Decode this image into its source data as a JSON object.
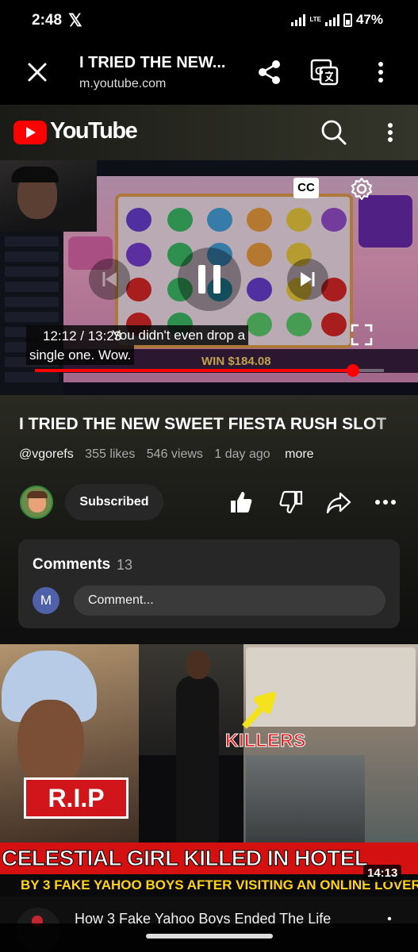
{
  "status_bar": {
    "time": "2:48",
    "notification_app": "𝕏",
    "network": "LTE",
    "battery": "47%"
  },
  "toolbar": {
    "title": "I TRIED THE NEW...",
    "url": "m.youtube.com",
    "close_icon": "close-icon",
    "share_icon": "share-icon",
    "translate_icon": "translate-icon",
    "menu_icon": "more-vert-icon"
  },
  "youtube_header": {
    "logo_text": "YouTube",
    "colors": {
      "brand": "#ff0000"
    }
  },
  "player": {
    "current_time": "12:12",
    "duration": "13:23",
    "time_display": "12:12 / 13:23",
    "progress_fraction": 0.9116,
    "caption_line1": "You didn't even drop a",
    "caption_line2": "single one. Wow.",
    "cc_label": "CC",
    "game_win_text": "WIN $184.08"
  },
  "video_info": {
    "title": "I TRIED THE NEW SWEET FIESTA RUSH SLOT",
    "channel": "@vgorefs",
    "likes": "355 likes",
    "views": "546 views",
    "age": "1 day ago",
    "more_label": "more",
    "subscribe_label": "Subscribed"
  },
  "comments": {
    "label": "Comments",
    "count": "13",
    "user_initial": "M",
    "placeholder": "Comment..."
  },
  "next_video": {
    "thumbnail_rip": "R.I.P",
    "thumbnail_killers": "KILLERS",
    "thumbnail_headline": "CELESTIAL GIRL KILLED IN HOTEL",
    "thumbnail_subline": "BY 3 FAKE YAHOO BOYS AFTER VISITING AN ONLINE LOVER",
    "duration": "14:13",
    "title": "How 3 Fake Yahoo Boys Ended The Life"
  }
}
